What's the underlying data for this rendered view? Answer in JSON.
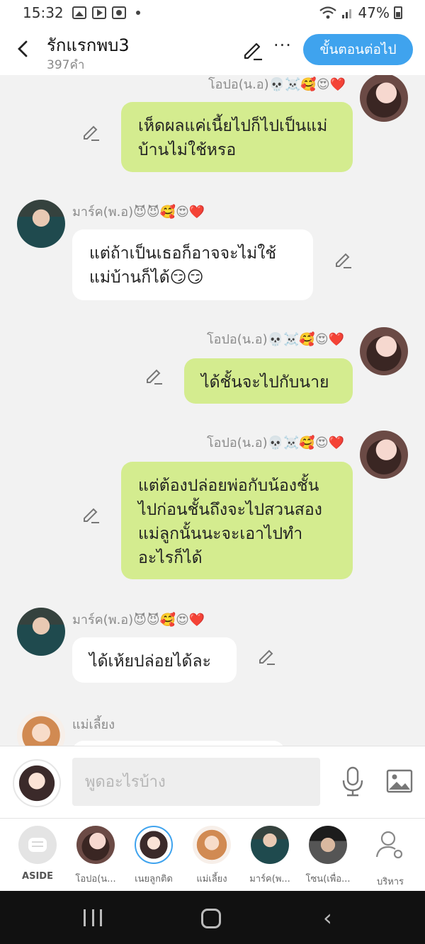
{
  "status": {
    "time": "15:32",
    "battery": "47%"
  },
  "header": {
    "back_icon": "chevron-left-icon",
    "title": "รักแรกพบ3",
    "word_count": "397คำ",
    "next_label": "ขั้นตอนต่อไป",
    "accent": "#3fa3ee"
  },
  "messages": [
    {
      "side": "me",
      "name": "โอปอ(น.อ)💀☠️🥰😍❤️",
      "text": "เห็ดผลแค่เนี้ยไปก็ไปเป็นแม่บ้านไม่ใช้หรอ"
    },
    {
      "side": "other",
      "name": "มาร์ค(พ.อ)😈😈🥰😍❤️",
      "text": "แต่ถ้าเป็นเธอก็อาจจะไม่ใช้แม่บ้านก็ได้😏😏"
    },
    {
      "side": "me",
      "name": "โอปอ(น.อ)💀☠️🥰😍❤️",
      "text": "ได้ชั้นจะไปกับนาย"
    },
    {
      "side": "me",
      "name": "โอปอ(น.อ)💀☠️🥰😍❤️",
      "text": "แต่ต้องปล่อยพ่อกับน้องชั้นไปก่อนชั้นถึงจะไปสวนสองแม่ลูกนั้นนะจะเอาไปทำอะไรก็ได้"
    },
    {
      "side": "other",
      "name": "มาร์ค(พ.อ)😈😈🥰😍❤️",
      "text": "ได้เห้ยปล่อยได้ละ"
    },
    {
      "side": "other",
      "name": "แม่เลี้ยง",
      "text": ""
    }
  ],
  "input": {
    "placeholder": "พูดอะไรบ้าง"
  },
  "characters": [
    {
      "label": "ASIDE"
    },
    {
      "label": "โอปอ(น..."
    },
    {
      "label": "เนยลูกติด"
    },
    {
      "label": "แม่เลี้ยง"
    },
    {
      "label": "มาร์ค(พ..."
    },
    {
      "label": "โซน(เพื่อ..."
    },
    {
      "label": "บริหาร"
    }
  ],
  "colors": {
    "me_bubble": "#d4ec8f",
    "other_bubble": "#ffffff",
    "background": "#f2f2f2"
  }
}
